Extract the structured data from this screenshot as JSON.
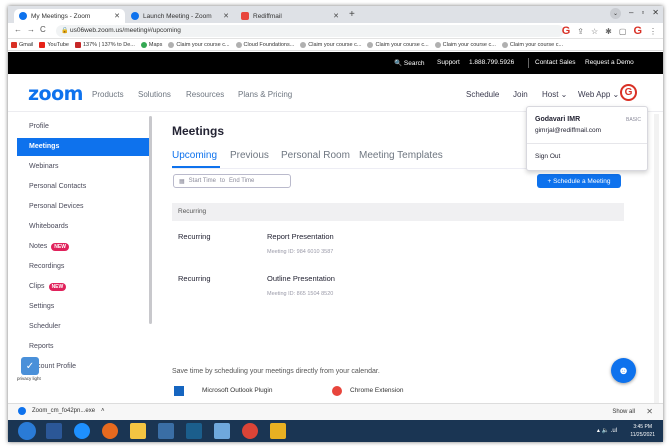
{
  "browser": {
    "tabs": [
      {
        "label": "My Meetings - Zoom",
        "active": true
      },
      {
        "label": "Launch Meeting - Zoom",
        "active": false
      },
      {
        "label": "Rediffmail",
        "active": false
      }
    ],
    "new_tab": "+",
    "address": "us06web.zoom.us/meeting#/upcoming",
    "bookmarks": [
      "Gmail",
      "YouTube",
      "137% | 137% to De...",
      "Maps",
      "Claim your course c...",
      "Cloud Foundations...",
      "Claim your course c...",
      "Claim your course c...",
      "Claim your course c...",
      "Claim your course c..."
    ],
    "colors": {
      "tabstrip": "#dee1e6",
      "accent": "#0e72ed"
    }
  },
  "zoom_topbar": {
    "search": "Search",
    "support": "Support",
    "phone": "1.888.799.5926",
    "contact_sales": "Contact Sales",
    "request_demo": "Request a Demo"
  },
  "zoom_nav": {
    "logo": "zoom",
    "left_items": [
      "Products",
      "Solutions",
      "Resources",
      "Plans & Pricing"
    ],
    "right_items": [
      "Schedule",
      "Join",
      "Host ⌄",
      "Web App ⌄"
    ],
    "profile_initial": "G"
  },
  "sidebar": {
    "items": [
      {
        "label": "Profile",
        "active": false,
        "badge": ""
      },
      {
        "label": "Meetings",
        "active": true,
        "badge": ""
      },
      {
        "label": "Webinars",
        "active": false,
        "badge": ""
      },
      {
        "label": "Personal Contacts",
        "active": false,
        "badge": ""
      },
      {
        "label": "Personal Devices",
        "active": false,
        "badge": ""
      },
      {
        "label": "Whiteboards",
        "active": false,
        "badge": ""
      },
      {
        "label": "Notes",
        "active": false,
        "badge": "NEW"
      },
      {
        "label": "Recordings",
        "active": false,
        "badge": ""
      },
      {
        "label": "Clips",
        "active": false,
        "badge": "NEW"
      },
      {
        "label": "Settings",
        "active": false,
        "badge": ""
      },
      {
        "label": "Scheduler",
        "active": false,
        "badge": ""
      },
      {
        "label": "Reports",
        "active": false,
        "badge": ""
      },
      {
        "label": "Account Profile",
        "active": false,
        "badge": ""
      }
    ],
    "shield_caption": "privacy light"
  },
  "main": {
    "title": "Meetings",
    "tabs": [
      "Upcoming",
      "Previous",
      "Personal Room",
      "Meeting Templates"
    ],
    "active_tab": "Upcoming",
    "start_time_placeholder": "Start Time",
    "to_label": "to",
    "end_time_placeholder": "End Time",
    "schedule_button": "+ Schedule a Meeting",
    "section_header": "Recurring",
    "meetings": [
      {
        "kind": "Recurring",
        "title": "Report Presentation",
        "meeting_id": "Meeting ID: 984 6010 3587"
      },
      {
        "kind": "Recurring",
        "title": "Outline Presentation",
        "meeting_id": "Meeting ID: 865 1504 8520"
      }
    ],
    "promo_text": "Save time by scheduling your meetings directly from your calendar.",
    "promo_items": [
      "Microsoft Outlook Plugin",
      "Chrome Extension"
    ]
  },
  "account_menu": {
    "name": "Godavari IMR",
    "plan": "BASIC",
    "email": "gimrjal@rediffmail.com",
    "sign_out": "Sign Out"
  },
  "downloads": {
    "file": "Zoom_cm_fo42pn...exe",
    "chevron": "˄",
    "show_all": "Show all",
    "close": "✕"
  },
  "taskbar": {
    "time": "3:45 PM",
    "date": "11/25/2021",
    "tray": "▴ 🔈 .ul"
  }
}
